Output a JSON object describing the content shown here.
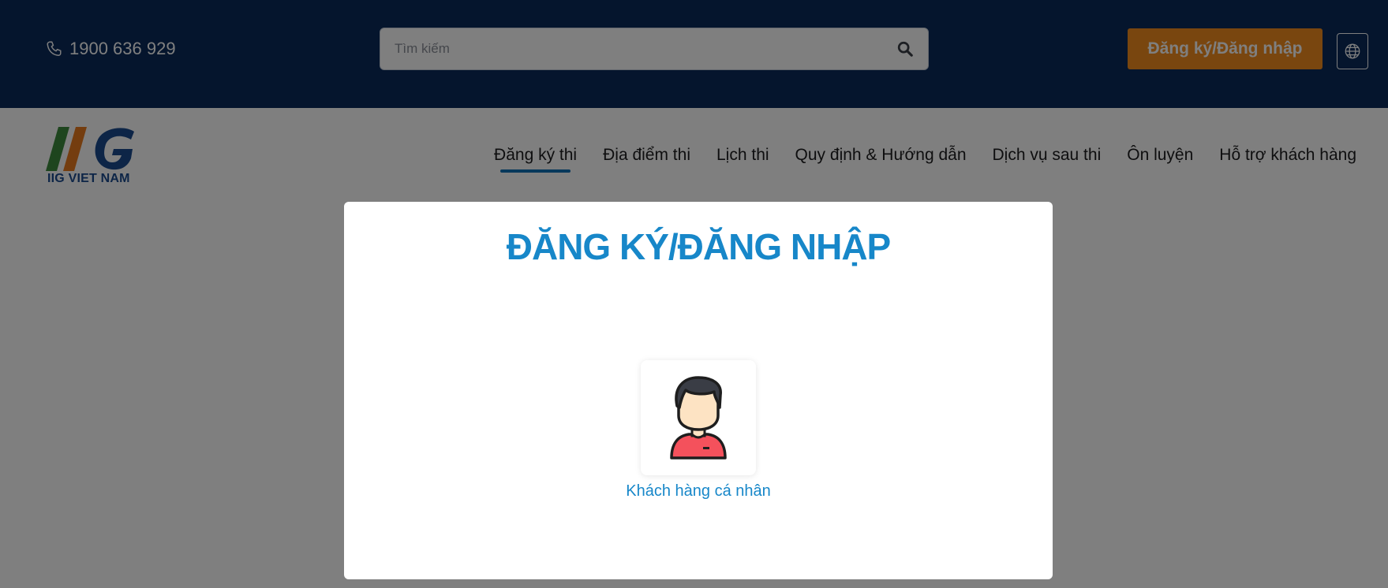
{
  "topbar": {
    "phone": "1900 636 929",
    "phone_icon": "phone-icon",
    "search_placeholder": "Tìm kiếm",
    "search_icon": "search-icon",
    "login_label": "Đăng ký/Đăng nhập",
    "language_icon": "globe-icon"
  },
  "header": {
    "logo_text": "IIG VIET NAM",
    "nav": [
      {
        "label": "Đăng ký thi",
        "active": true
      },
      {
        "label": "Địa điểm thi"
      },
      {
        "label": "Lịch thi"
      },
      {
        "label": "Quy định & Hướng dẫn"
      },
      {
        "label": "Dịch vụ sau thi"
      },
      {
        "label": "Ôn luyện"
      },
      {
        "label": "Hỗ trợ khách hàng"
      }
    ]
  },
  "modal": {
    "title": "ĐĂNG KÝ/ĐĂNG NHẬP",
    "options": [
      {
        "label": "Khách hàng cá nhân",
        "icon": "person-avatar-icon"
      }
    ]
  },
  "colors": {
    "topbar_bg": "#0a2a5b",
    "accent_orange": "#f28c1e",
    "accent_blue": "#1787c9",
    "nav_underline": "#0e70b6",
    "logo_green": "#3d8b3d",
    "logo_orange": "#e87b1e",
    "logo_blue": "#1a4a8f"
  }
}
